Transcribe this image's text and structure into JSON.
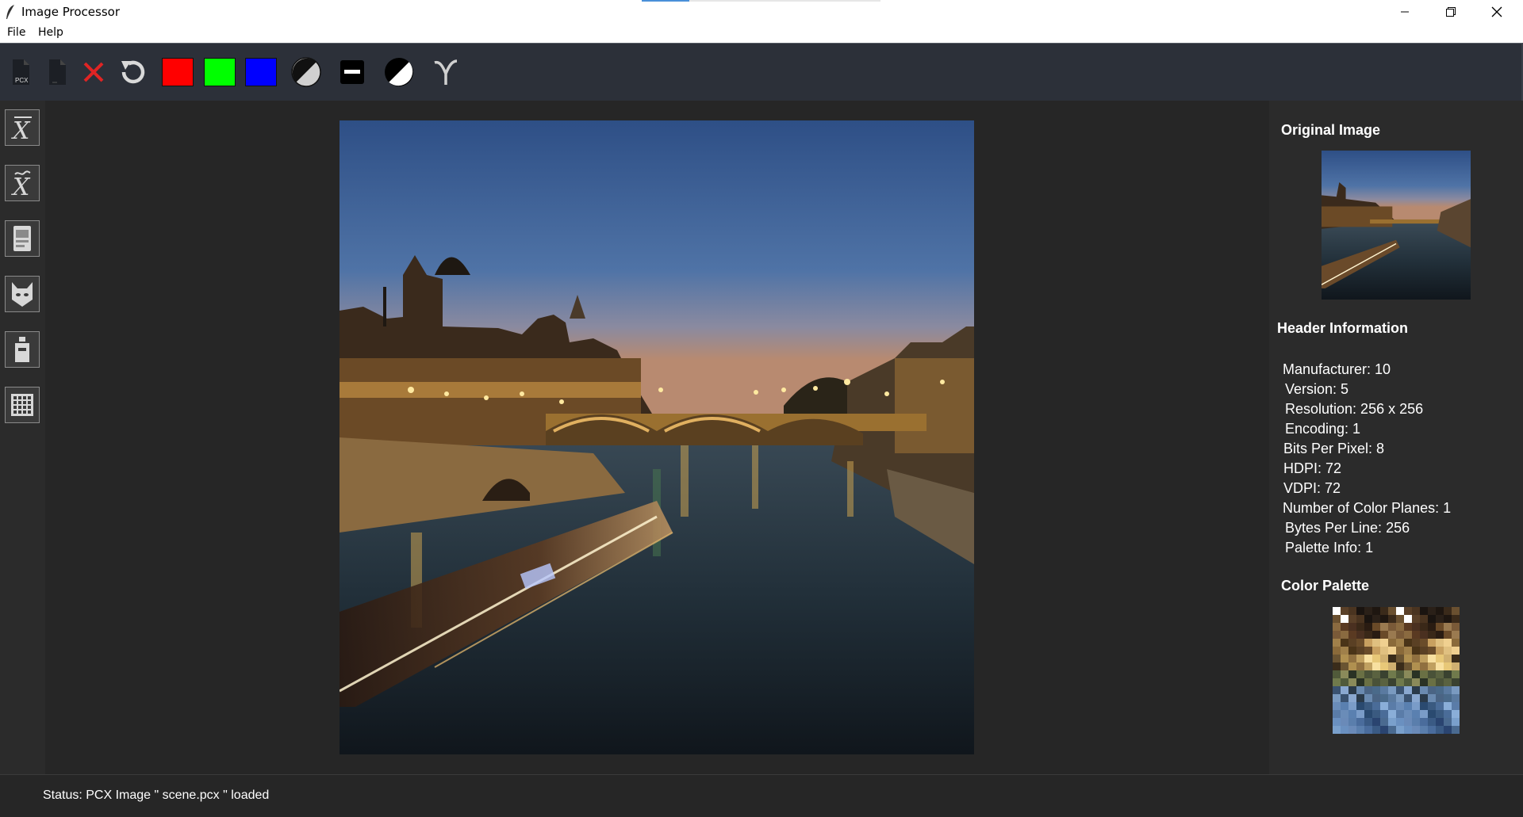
{
  "window": {
    "title": "Image Processor",
    "controls": [
      "minimize",
      "restore",
      "close"
    ]
  },
  "menu": {
    "items": [
      "File",
      "Help"
    ]
  },
  "toolbar": {
    "pcx_label": "PCX",
    "buttons": [
      {
        "name": "pcx-file-icon"
      },
      {
        "name": "blank-file-icon"
      },
      {
        "name": "close-icon",
        "color": "#e02424"
      },
      {
        "name": "undo-icon"
      },
      {
        "name": "red-channel-swatch",
        "color": "#ff0000"
      },
      {
        "name": "green-channel-swatch",
        "color": "#00ff00"
      },
      {
        "name": "blue-channel-swatch",
        "color": "#0000ff"
      },
      {
        "name": "grayscale-icon"
      },
      {
        "name": "equalize-icon"
      },
      {
        "name": "negative-icon"
      },
      {
        "name": "gamma-icon"
      }
    ]
  },
  "sidebar": {
    "tools": [
      {
        "name": "mean-filter-icon",
        "symbol": "X̅"
      },
      {
        "name": "median-filter-icon",
        "symbol": "X̃"
      },
      {
        "name": "laplacian-icon"
      },
      {
        "name": "cat-mask-icon"
      },
      {
        "name": "gradient-icon"
      },
      {
        "name": "grid-icon"
      }
    ]
  },
  "right_panel": {
    "original_heading": "Original Image",
    "header_heading": "Header Information",
    "header_info": [
      "Manufacturer: 10",
      "Version: 5",
      "Resolution: 256 x 256",
      "Encoding: 1",
      "Bits Per Pixel: 8",
      "HDPI: 72",
      "VDPI: 72",
      "Number of Color Planes: 1",
      "Bytes Per Line: 256",
      "Palette Info: 1"
    ],
    "palette_heading": "Color Palette"
  },
  "status": {
    "text": "Status: PCX Image \" scene.pcx \" loaded"
  },
  "colors": {
    "toolbar_bg": "#2c3039",
    "workarea_bg": "#262626",
    "panel_bg": "#2b2b2b"
  }
}
